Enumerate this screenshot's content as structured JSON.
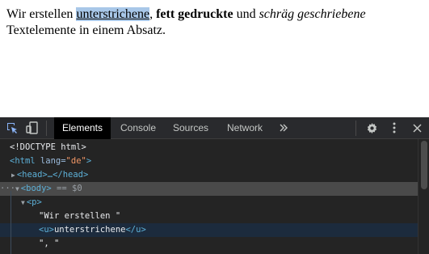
{
  "page": {
    "text_before": "Wir erstellen ",
    "underlined": "unterstrichene",
    "comma": ", ",
    "bold": "fett gedruckte",
    "und": " und ",
    "italic": "schräg geschriebene",
    "text_after": " Textelemente in einem Absatz."
  },
  "devtools": {
    "tabs": [
      "Elements",
      "Console",
      "Sources",
      "Network"
    ],
    "active_tab": "Elements",
    "icons": {
      "inspect": "inspect-element-icon",
      "device": "device-toolbar-icon",
      "more_tabs": "more-tabs-icon",
      "settings": "gear-icon",
      "menu": "kebab-menu-icon",
      "close": "close-icon"
    },
    "dom_lines": {
      "l1": "<!DOCTYPE html>",
      "l2_open": "<html",
      "l2_attr": " lang=",
      "l2_val": "\"de\"",
      "l2_close": ">",
      "l3": "<head>…</head>",
      "l4_tag": "<body>",
      "l4_eq": " == $0",
      "l5": "<p>",
      "l6": "\"Wir erstellen \"",
      "l7_open": "<u>",
      "l7_text": "unterstrichene",
      "l7_close": "</u>",
      "l8": "\", \""
    },
    "colors": {
      "tag": "#5db0d7",
      "attr_value": "#f29766",
      "panel_bg": "#242424",
      "selected_row": "#4a4a4a"
    }
  }
}
